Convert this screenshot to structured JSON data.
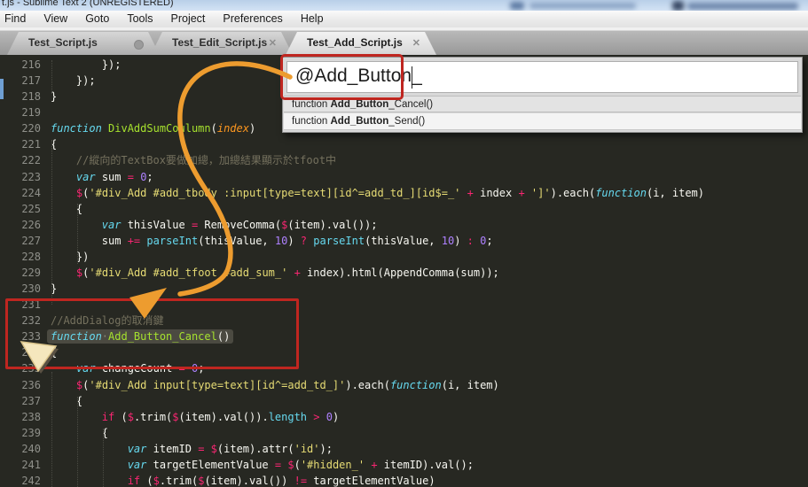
{
  "window": {
    "title": "t.js - Sublime Text 2 (UNREGISTERED)"
  },
  "menu": {
    "items": [
      "Find",
      "View",
      "Goto",
      "Tools",
      "Project",
      "Preferences",
      "Help"
    ]
  },
  "tabs": [
    {
      "label": "Test_Script.js",
      "indicator": "dot",
      "active": false
    },
    {
      "label": "Test_Edit_Script.js",
      "indicator": "close",
      "active": false
    },
    {
      "label": "Test_Add_Script.js",
      "indicator": "close",
      "active": true
    }
  ],
  "autocomplete": {
    "input_value": "@Add_Button_",
    "suggestions": [
      {
        "pre": "function ",
        "bold": "Add_Button",
        "post": "_Cancel()"
      },
      {
        "pre": "function ",
        "bold": "Add_Button",
        "post": "_Send()"
      }
    ]
  },
  "editor": {
    "first_line_number": 216,
    "lines": [
      {
        "n": "216",
        "seg": [
          [
            "p",
            "        });"
          ]
        ]
      },
      {
        "n": "217",
        "seg": [
          [
            "p",
            "    });"
          ]
        ]
      },
      {
        "n": "218",
        "seg": [
          [
            "p",
            "}"
          ]
        ]
      },
      {
        "n": "219",
        "seg": []
      },
      {
        "n": "220",
        "seg": [
          [
            "v",
            "function"
          ],
          [
            "p",
            " "
          ],
          [
            "f",
            "DivAddSumCoulumn"
          ],
          [
            "p",
            "("
          ],
          [
            "a",
            "index"
          ],
          [
            "p",
            ")"
          ]
        ]
      },
      {
        "n": "221",
        "seg": [
          [
            "p",
            "{"
          ]
        ]
      },
      {
        "n": "222",
        "seg": [
          [
            "c",
            "    //縱向的TextBox要做加總，加總結果顯示於tfoot中"
          ]
        ]
      },
      {
        "n": "223",
        "seg": [
          [
            "p",
            "    "
          ],
          [
            "v",
            "var"
          ],
          [
            "p",
            " sum "
          ],
          [
            "k",
            "="
          ],
          [
            "p",
            " "
          ],
          [
            "n",
            "0"
          ],
          [
            "p",
            ";"
          ]
        ]
      },
      {
        "n": "224",
        "seg": [
          [
            "p",
            "    "
          ],
          [
            "k",
            "$"
          ],
          [
            "p",
            "("
          ],
          [
            "s",
            "'#div_Add #add_tbody :input[type=text][id^=add_td_][id$=_'"
          ],
          [
            "p",
            " "
          ],
          [
            "k",
            "+"
          ],
          [
            "p",
            " index "
          ],
          [
            "k",
            "+"
          ],
          [
            "p",
            " "
          ],
          [
            "s",
            "']'"
          ],
          [
            "p",
            ").each("
          ],
          [
            "v",
            "function"
          ],
          [
            "p",
            "(i, item)"
          ]
        ]
      },
      {
        "n": "225",
        "seg": [
          [
            "p",
            "    {"
          ]
        ]
      },
      {
        "n": "226",
        "seg": [
          [
            "p",
            "        "
          ],
          [
            "v",
            "var"
          ],
          [
            "p",
            " thisValue "
          ],
          [
            "k",
            "="
          ],
          [
            "p",
            " RemoveComma("
          ],
          [
            "k",
            "$"
          ],
          [
            "p",
            "(item).val());"
          ]
        ]
      },
      {
        "n": "227",
        "seg": [
          [
            "p",
            "        sum "
          ],
          [
            "k",
            "+="
          ],
          [
            "p",
            " "
          ],
          [
            "b",
            "parseInt"
          ],
          [
            "p",
            "(thisValue, "
          ],
          [
            "n",
            "10"
          ],
          [
            "p",
            ") "
          ],
          [
            "k",
            "?"
          ],
          [
            "p",
            " "
          ],
          [
            "b",
            "parseInt"
          ],
          [
            "p",
            "(thisValue, "
          ],
          [
            "n",
            "10"
          ],
          [
            "p",
            ") "
          ],
          [
            "k",
            ":"
          ],
          [
            "p",
            " "
          ],
          [
            "n",
            "0"
          ],
          [
            "p",
            ";"
          ]
        ]
      },
      {
        "n": "228",
        "seg": [
          [
            "p",
            "    })"
          ]
        ]
      },
      {
        "n": "229",
        "seg": [
          [
            "p",
            "    "
          ],
          [
            "k",
            "$"
          ],
          [
            "p",
            "("
          ],
          [
            "s",
            "'#div_Add #add_tfoot #add_sum_'"
          ],
          [
            "p",
            " "
          ],
          [
            "k",
            "+"
          ],
          [
            "p",
            " index).html(AppendComma(sum));"
          ]
        ]
      },
      {
        "n": "230",
        "seg": [
          [
            "p",
            "}"
          ]
        ]
      },
      {
        "n": "231",
        "seg": []
      },
      {
        "n": "232",
        "seg": [
          [
            "c",
            "//AddDialog的取消鍵"
          ]
        ]
      },
      {
        "n": "233",
        "hl": true,
        "seg": [
          [
            "v",
            "function"
          ],
          [
            "w",
            "·"
          ],
          [
            "f",
            "Add_Button_Cancel"
          ],
          [
            "p",
            "()"
          ]
        ]
      },
      {
        "n": "234",
        "seg": [
          [
            "p",
            "{"
          ]
        ]
      },
      {
        "n": "235",
        "seg": [
          [
            "p",
            "    "
          ],
          [
            "v",
            "var"
          ],
          [
            "p",
            " changeCount "
          ],
          [
            "k",
            "="
          ],
          [
            "p",
            " "
          ],
          [
            "n",
            "0"
          ],
          [
            "p",
            ";"
          ]
        ]
      },
      {
        "n": "236",
        "seg": [
          [
            "p",
            "    "
          ],
          [
            "k",
            "$"
          ],
          [
            "p",
            "("
          ],
          [
            "s",
            "'#div_Add input[type=text][id^=add_td_]'"
          ],
          [
            "p",
            ").each("
          ],
          [
            "v",
            "function"
          ],
          [
            "p",
            "(i, item)"
          ]
        ]
      },
      {
        "n": "237",
        "seg": [
          [
            "p",
            "    {"
          ]
        ]
      },
      {
        "n": "238",
        "seg": [
          [
            "p",
            "        "
          ],
          [
            "k",
            "if"
          ],
          [
            "p",
            " ("
          ],
          [
            "k",
            "$"
          ],
          [
            "p",
            ".trim("
          ],
          [
            "k",
            "$"
          ],
          [
            "p",
            "(item).val())."
          ],
          [
            "b",
            "length"
          ],
          [
            "p",
            " "
          ],
          [
            "k",
            ">"
          ],
          [
            "p",
            " "
          ],
          [
            "n",
            "0"
          ],
          [
            "p",
            ")"
          ]
        ]
      },
      {
        "n": "239",
        "seg": [
          [
            "p",
            "        {"
          ]
        ]
      },
      {
        "n": "240",
        "seg": [
          [
            "p",
            "            "
          ],
          [
            "v",
            "var"
          ],
          [
            "p",
            " itemID "
          ],
          [
            "k",
            "="
          ],
          [
            "p",
            " "
          ],
          [
            "k",
            "$"
          ],
          [
            "p",
            "(item).attr("
          ],
          [
            "s",
            "'id'"
          ],
          [
            "p",
            ");"
          ]
        ]
      },
      {
        "n": "241",
        "seg": [
          [
            "p",
            "            "
          ],
          [
            "v",
            "var"
          ],
          [
            "p",
            " targetElementValue "
          ],
          [
            "k",
            "="
          ],
          [
            "p",
            " "
          ],
          [
            "k",
            "$"
          ],
          [
            "p",
            "("
          ],
          [
            "s",
            "'#hidden_'"
          ],
          [
            "p",
            " "
          ],
          [
            "k",
            "+"
          ],
          [
            "p",
            " itemID).val();"
          ]
        ]
      },
      {
        "n": "242",
        "seg": [
          [
            "p",
            "            "
          ],
          [
            "k",
            "if"
          ],
          [
            "p",
            " ("
          ],
          [
            "k",
            "$"
          ],
          [
            "p",
            ".trim("
          ],
          [
            "k",
            "$"
          ],
          [
            "p",
            "(item).val()) "
          ],
          [
            "k",
            "!="
          ],
          [
            "p",
            " targetElementValue)"
          ]
        ]
      }
    ]
  },
  "colors": {
    "editor_bg": "#272822",
    "keyword_pink": "#f92672",
    "builtin_cyan": "#66d9ef",
    "function_green": "#a6e22e",
    "string_yellow": "#e6db74",
    "number_purple": "#ae81ff",
    "comment_gray": "#75715e",
    "annotation_red": "#bf2620",
    "annotation_orange": "#ed9c2f",
    "pointer_cream": "#f5e7bd"
  }
}
